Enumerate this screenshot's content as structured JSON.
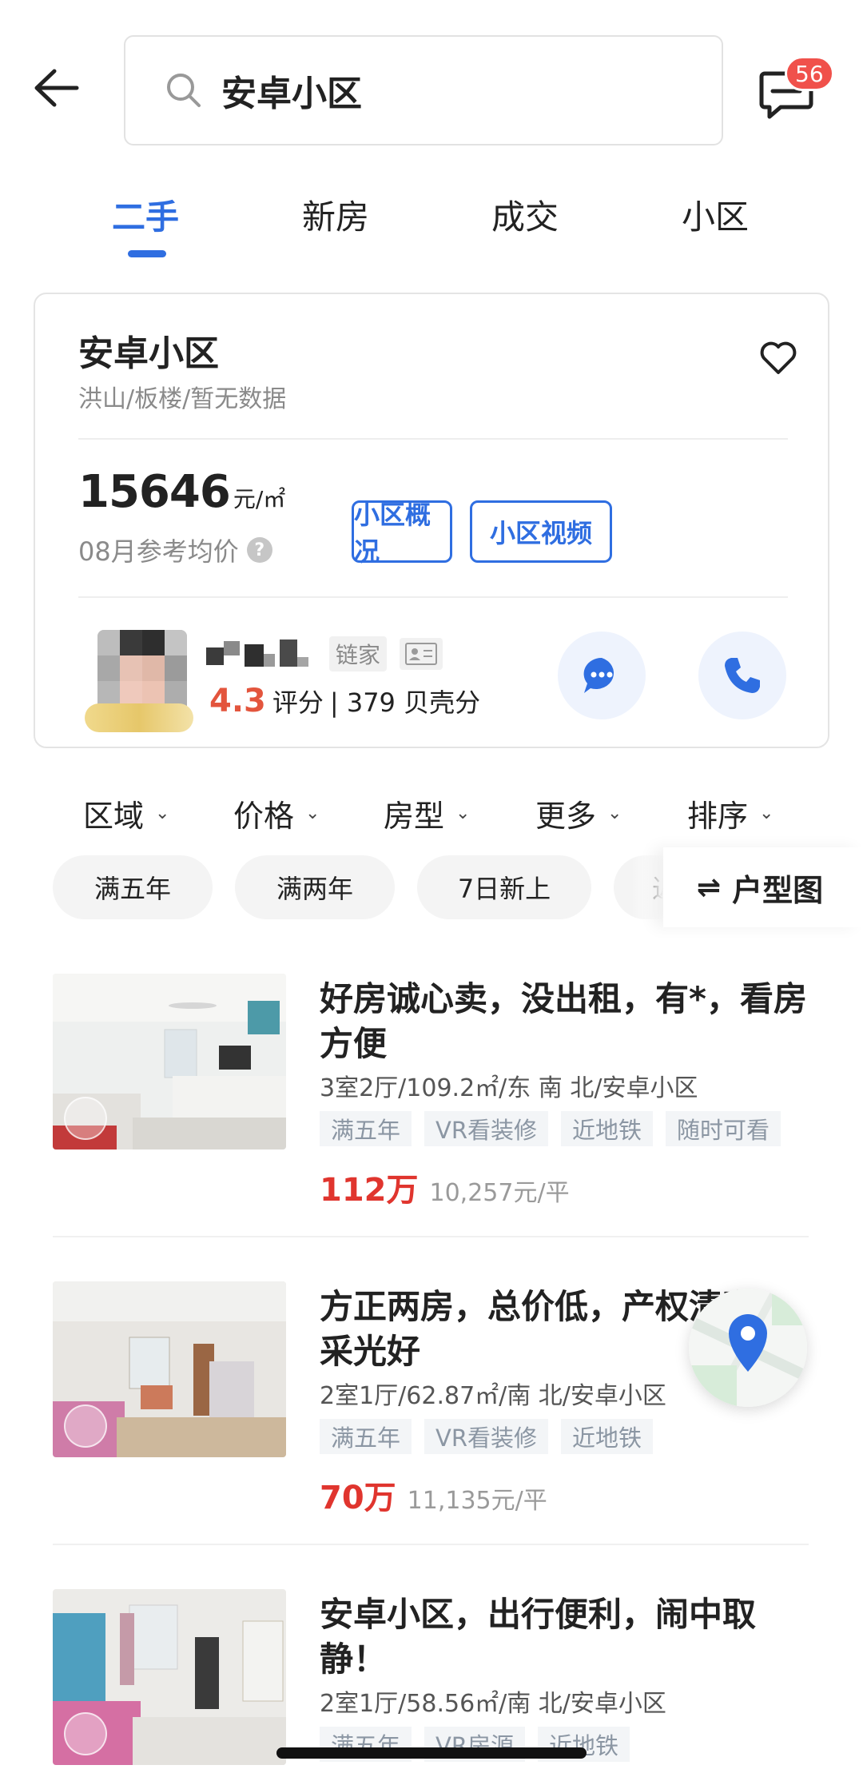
{
  "header": {
    "search_text": "安卓小区",
    "message_badge": "56"
  },
  "tabs": [
    {
      "label": "二手",
      "active": true
    },
    {
      "label": "新房",
      "active": false
    },
    {
      "label": "成交",
      "active": false
    },
    {
      "label": "小区",
      "active": false
    }
  ],
  "community": {
    "name": "安卓小区",
    "subtitle": "洪山/板楼/暂无数据",
    "price": "15646",
    "price_unit": "元/㎡",
    "price_caption": "08月参考均价",
    "overview_button": "小区概况",
    "video_button": "小区视频"
  },
  "agent": {
    "company": "链家",
    "score": "4.3",
    "score_label": "评分",
    "shell_points": "| 379 贝壳分"
  },
  "filters": [
    "区域",
    "价格",
    "房型",
    "更多",
    "排序"
  ],
  "chips": [
    "满五年",
    "满两年",
    "7日新上",
    "近"
  ],
  "floorplan_label": "户型图",
  "listings": [
    {
      "title": "好房诚心卖，没出租，有*，看房方便",
      "meta": "3室2厅/109.2㎡/东 南 北/安卓小区",
      "tags": [
        "满五年",
        "VR看装修",
        "近地铁",
        "随时可看"
      ],
      "price": "112万",
      "unit_price": "10,257元/平"
    },
    {
      "title": "方正两房，总价低，产权清晰，采光好",
      "meta": "2室1厅/62.87㎡/南 北/安卓小区",
      "tags": [
        "满五年",
        "VR看装修",
        "近地铁"
      ],
      "price": "70万",
      "unit_price": "11,135元/平"
    },
    {
      "title": "安卓小区，出行便利，闹中取静！",
      "meta": "2室1厅/58.56㎡/南 北/安卓小区",
      "tags": [
        "满五年",
        "VR房源",
        "近地铁"
      ]
    }
  ],
  "colors": {
    "accent": "#2f6ee1",
    "price_red": "#e0352e",
    "score_orange": "#e3553d",
    "badge_red": "#f0514b"
  }
}
